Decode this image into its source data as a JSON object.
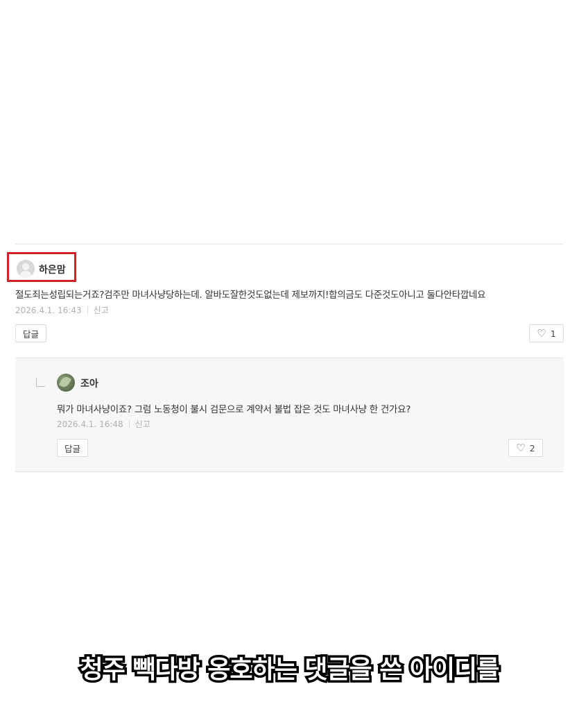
{
  "comment": {
    "nickname": "하은맘",
    "text": "절도죄는성립되는거죠?검주만 마녀사냥당하는데. 알바도잘한것도없는데 제보까지!합의금도 다준것도아니고 둘다안타깝네요",
    "date": "2026.4.1. 16:43",
    "report_label": "신고",
    "reply_button": "답글",
    "like_count": "1"
  },
  "reply": {
    "nickname": "조아",
    "text": "뭐가 마녀사냥이죠? 그럼 노동청이 불시 검문으로 계약서 불법 잡은 것도 마녀사냥 한 건가요?",
    "date": "2026.4.1. 16:48",
    "report_label": "신고",
    "reply_button": "답글",
    "like_count": "2"
  },
  "caption": "청주 빽다방 옹호하는 댓글을 쓴 아이디를",
  "colors": {
    "highlight_border": "#d32027",
    "reply_background": "#f7f7f7"
  }
}
